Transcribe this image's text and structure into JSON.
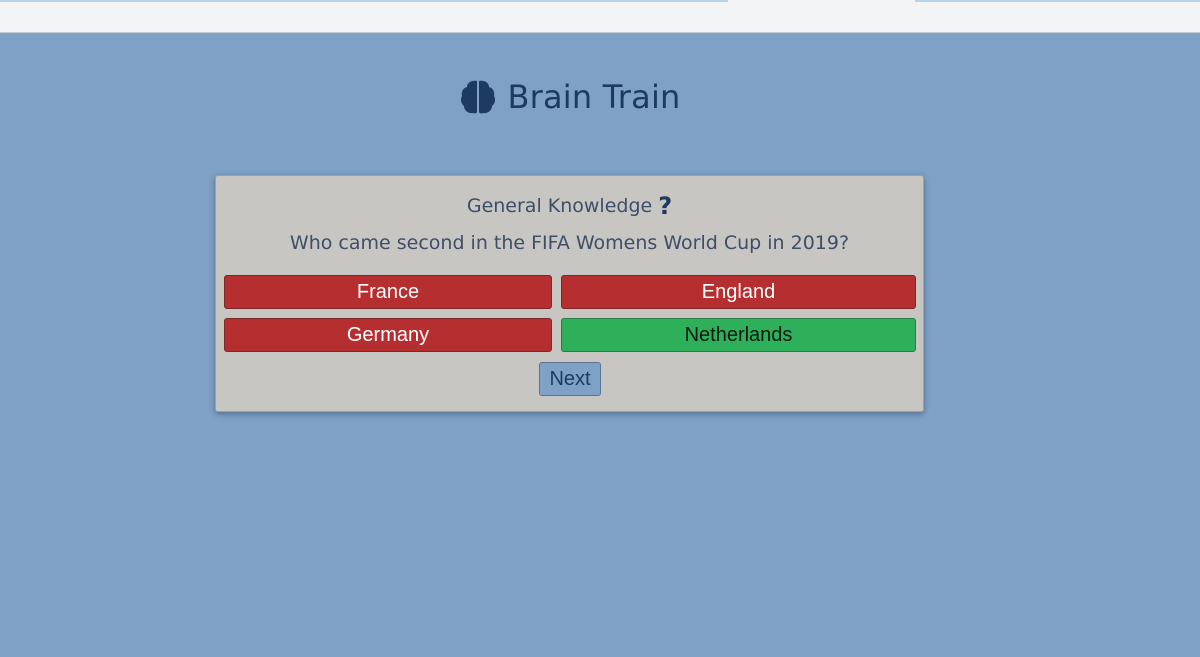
{
  "app": {
    "title": "Brain Train",
    "logo_icon": "brain-icon"
  },
  "quiz": {
    "category": "General Knowledge",
    "category_icon": "question-mark-icon",
    "category_icon_glyph": "?",
    "question": "Who came second in the FIFA Womens World Cup in 2019?",
    "answers": [
      {
        "label": "France",
        "state": "incorrect"
      },
      {
        "label": "England",
        "state": "incorrect"
      },
      {
        "label": "Germany",
        "state": "incorrect"
      },
      {
        "label": "Netherlands",
        "state": "correct"
      }
    ],
    "next_label": "Next"
  },
  "colors": {
    "background": "#7fa1c6",
    "card": "#c7c6c3",
    "incorrect": "#b52f31",
    "correct": "#2eaf5a",
    "brand": "#1d3a63"
  }
}
